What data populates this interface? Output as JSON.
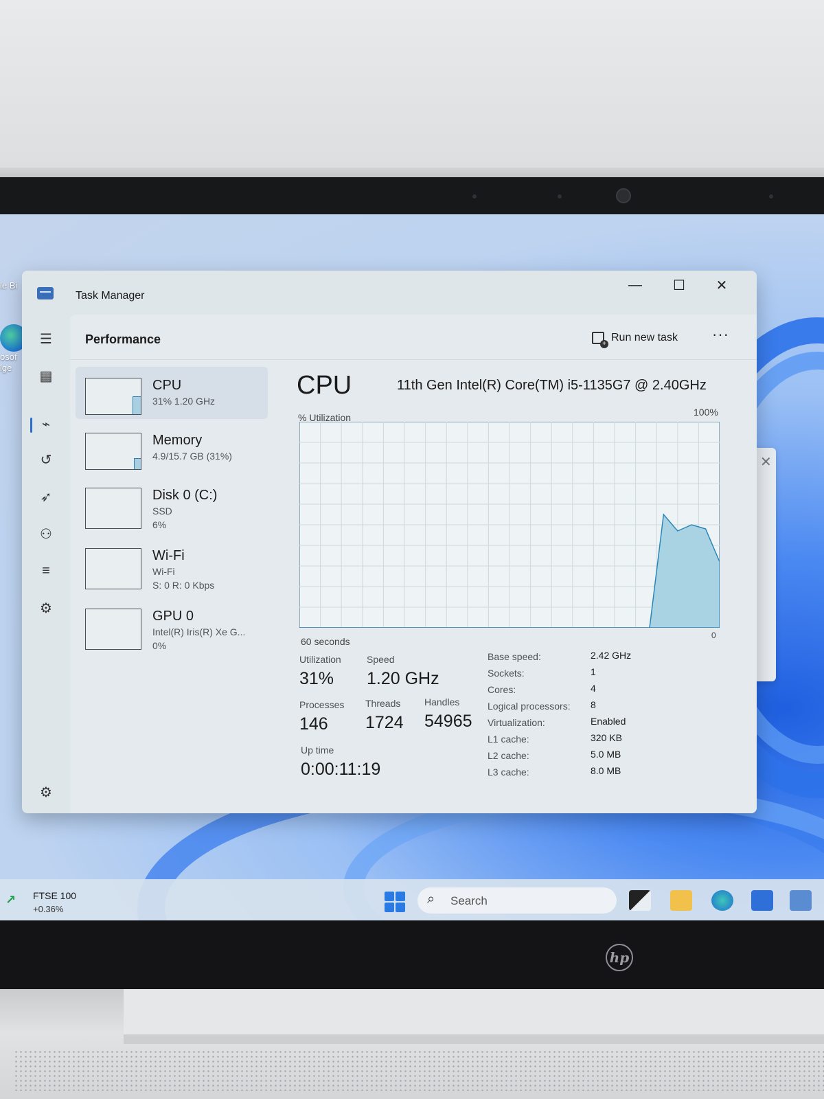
{
  "window": {
    "title": "Task Manager"
  },
  "desktop": {
    "icons": [
      {
        "label_lines": [
          "le Bi"
        ]
      },
      {
        "label_lines": [
          "osof",
          "lge"
        ]
      }
    ]
  },
  "header": {
    "page_title": "Performance",
    "run_new_task_label": "Run new task",
    "more_label": "···"
  },
  "nav_rail": {
    "items": [
      "hamburger-menu-icon",
      "processes-icon",
      "performance-icon",
      "app-history-icon",
      "startup-apps-icon",
      "users-icon",
      "details-icon",
      "services-icon",
      "settings-icon"
    ],
    "active": "performance-icon"
  },
  "devices": [
    {
      "name": "CPU",
      "sub1": "31% 1.20 GHz",
      "sub2": "",
      "level": 0.31
    },
    {
      "name": "Memory",
      "sub1": "4.9/15.7 GB (31%)",
      "sub2": "",
      "level": 0.31
    },
    {
      "name": "Disk 0 (C:)",
      "sub1": "SSD",
      "sub2": "6%",
      "level": 0.06
    },
    {
      "name": "Wi-Fi",
      "sub1": "Wi-Fi",
      "sub2": "S: 0 R: 0 Kbps",
      "level": 0
    },
    {
      "name": "GPU 0",
      "sub1": "Intel(R) Iris(R) Xe G...",
      "sub2": "0%",
      "level": 0
    }
  ],
  "cpu": {
    "title": "CPU",
    "model": "11th Gen Intel(R) Core(TM) i5-1135G7 @ 2.40GHz",
    "utilization_axis_label": "% Utilization",
    "max_label": "100%",
    "time_label": "60 seconds",
    "zero_label": "0",
    "stats": {
      "utilization_label": "Utilization",
      "utilization_value": "31%",
      "speed_label": "Speed",
      "speed_value": "1.20 GHz",
      "processes_label": "Processes",
      "processes_value": "146",
      "threads_label": "Threads",
      "threads_value": "1724",
      "handles_label": "Handles",
      "handles_value": "54965",
      "uptime_label": "Up time",
      "uptime_value": "0:00:11:19"
    },
    "specs": [
      {
        "key": "Base speed:",
        "value": "2.42 GHz"
      },
      {
        "key": "Sockets:",
        "value": "1"
      },
      {
        "key": "Cores:",
        "value": "4"
      },
      {
        "key": "Logical processors:",
        "value": "8"
      },
      {
        "key": "Virtualization:",
        "value": "Enabled"
      },
      {
        "key": "L1 cache:",
        "value": "320 KB"
      },
      {
        "key": "L2 cache:",
        "value": "5.0 MB"
      },
      {
        "key": "L3 cache:",
        "value": "8.0 MB"
      }
    ]
  },
  "chart_data": {
    "type": "area",
    "ylim": [
      0,
      100
    ],
    "x": [
      0,
      50,
      52,
      54,
      56,
      58,
      60
    ],
    "values": [
      0,
      0,
      55,
      47,
      50,
      48,
      32
    ]
  },
  "taskbar": {
    "widget_name": "FTSE 100",
    "widget_change": "+0.36%",
    "search_placeholder": "Search",
    "colors": {
      "accent": "#2a7ae4",
      "widget_up": "#1e9e4a"
    }
  }
}
